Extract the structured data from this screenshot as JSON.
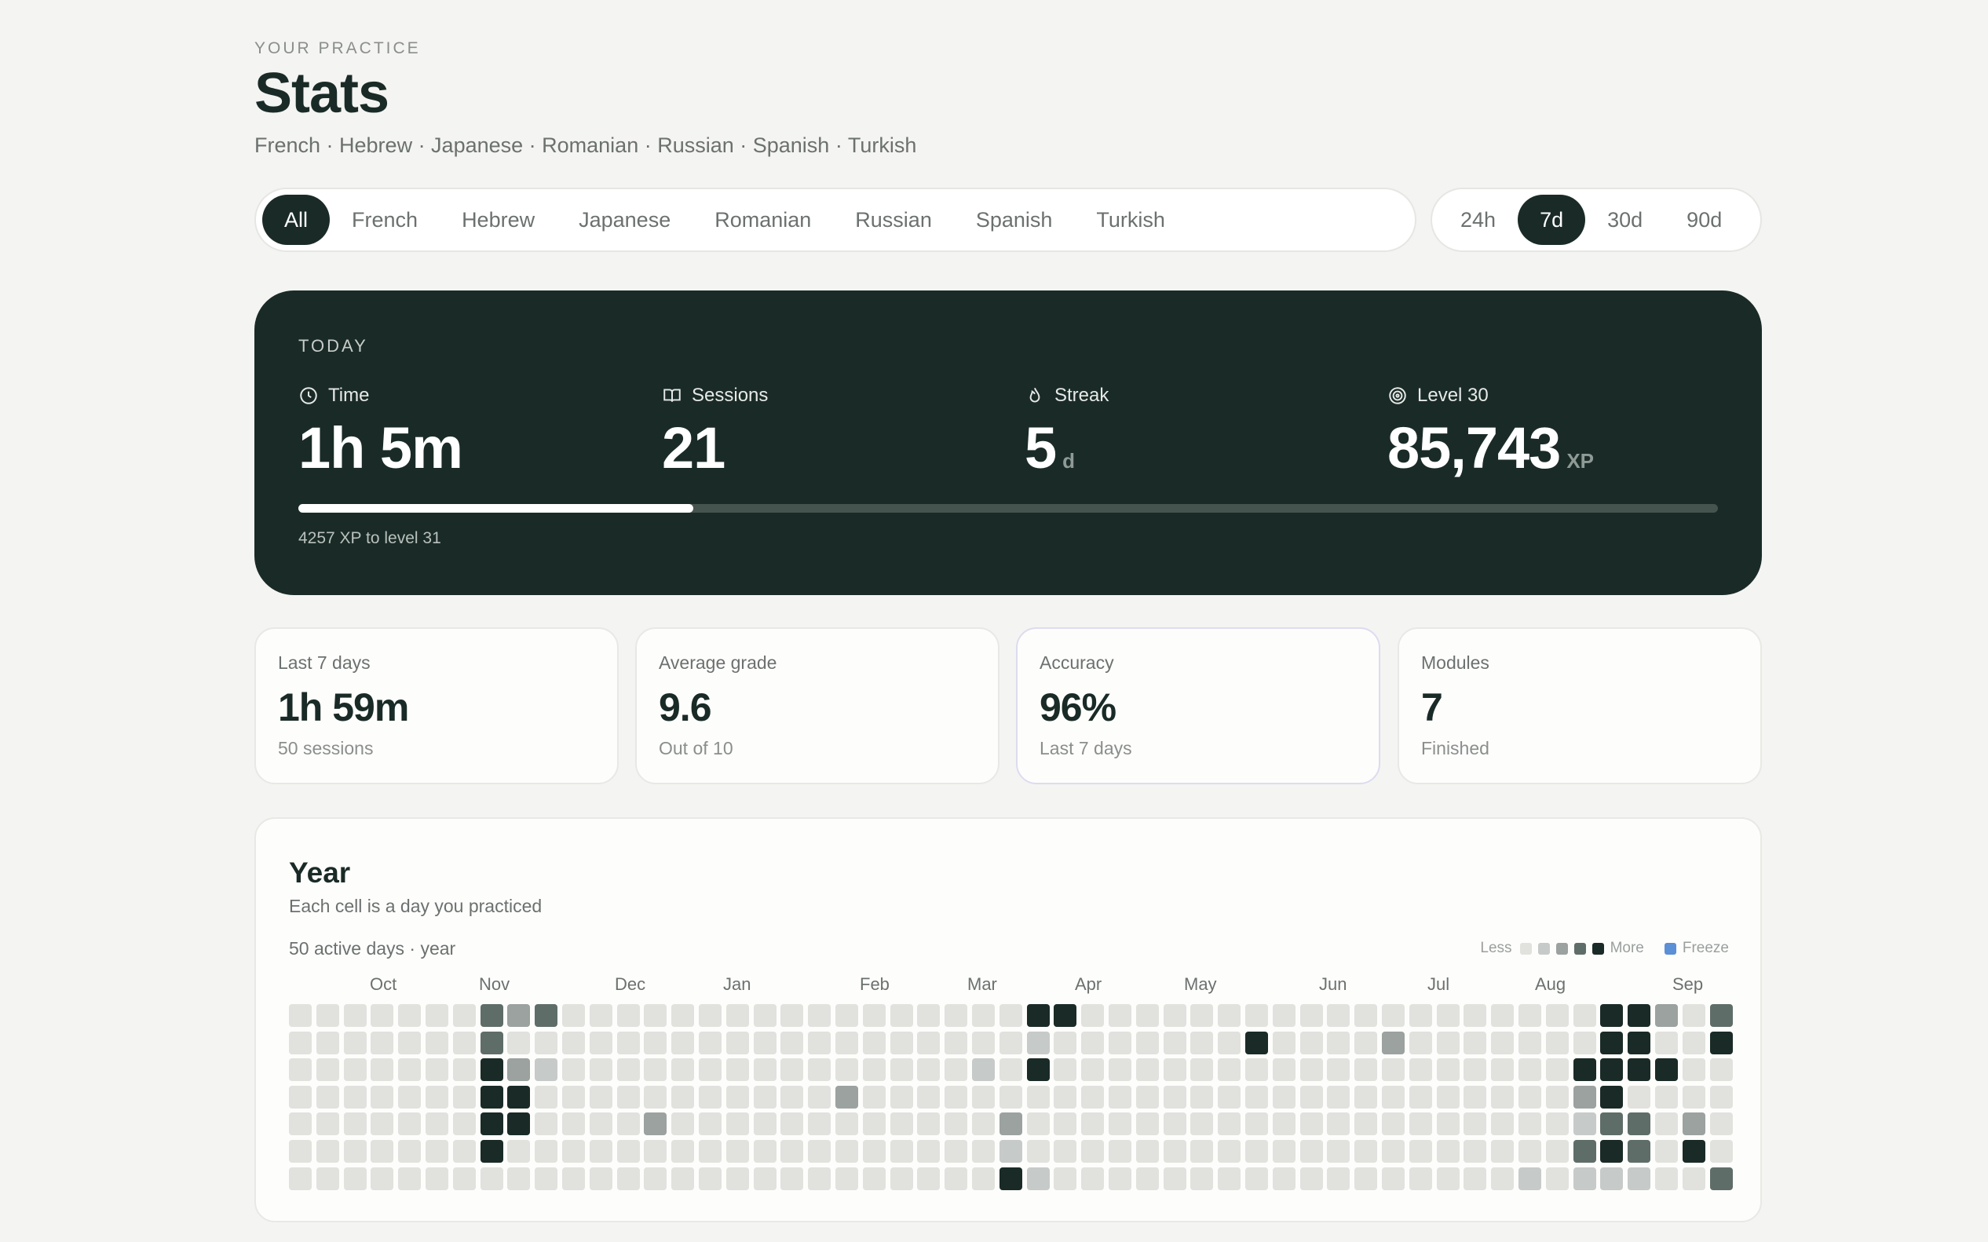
{
  "header": {
    "eyebrow": "YOUR PRACTICE",
    "title": "Stats",
    "languages_line": "French · Hebrew · Japanese · Romanian · Russian · Spanish · Turkish"
  },
  "language_filter": {
    "options": [
      "All",
      "French",
      "Hebrew",
      "Japanese",
      "Romanian",
      "Russian",
      "Spanish",
      "Turkish"
    ],
    "selected": "All"
  },
  "range_filter": {
    "options": [
      "24h",
      "7d",
      "30d",
      "90d"
    ],
    "selected": "7d"
  },
  "today": {
    "label": "TODAY",
    "time": {
      "label": "Time",
      "value": "1h 5m",
      "icon": "clock-icon"
    },
    "sessions": {
      "label": "Sessions",
      "value": "21",
      "icon": "book-icon"
    },
    "streak": {
      "label": "Streak",
      "value": "5",
      "unit": "d",
      "icon": "flame-icon"
    },
    "level": {
      "label": "Level 30",
      "value": "85,743",
      "unit": "XP",
      "icon": "target-icon"
    },
    "progress_fraction": 0.278,
    "xp_note": "4257 XP to level 31"
  },
  "cards": [
    {
      "label": "Last 7 days",
      "value": "1h 59m",
      "sub": "50 sessions"
    },
    {
      "label": "Average grade",
      "value": "9.6",
      "sub": "Out of 10"
    },
    {
      "label": "Accuracy",
      "value": "96%",
      "sub": "Last 7 days"
    },
    {
      "label": "Modules",
      "value": "7",
      "sub": "Finished"
    }
  ],
  "year": {
    "title": "Year",
    "subtitle": "Each cell is a day you practiced",
    "active": "50 active days · year",
    "legend": {
      "less": "Less",
      "more": "More",
      "freeze": "Freeze"
    },
    "months": [
      "Oct",
      "Nov",
      "Dec",
      "Jan",
      "Feb",
      "Mar",
      "Apr",
      "May",
      "Jun",
      "Jul",
      "Aug",
      "Sep"
    ],
    "colors": {
      "0": "#e1e1de",
      "1": "#c6cac8",
      "2": "#9ba29f",
      "3": "#5f6d68",
      "4": "#1a2b27",
      "freeze": "#5b8fd6"
    },
    "active_cells": [
      [
        7,
        0,
        3
      ],
      [
        8,
        0,
        2
      ],
      [
        9,
        0,
        3
      ],
      [
        7,
        1,
        3
      ],
      [
        7,
        2,
        4
      ],
      [
        8,
        2,
        2
      ],
      [
        9,
        2,
        1
      ],
      [
        7,
        3,
        4
      ],
      [
        8,
        3,
        4
      ],
      [
        7,
        4,
        4
      ],
      [
        8,
        4,
        4
      ],
      [
        7,
        5,
        4
      ],
      [
        13,
        4,
        2
      ],
      [
        20,
        3,
        2
      ],
      [
        25,
        2,
        1
      ],
      [
        26,
        4,
        2
      ],
      [
        26,
        5,
        1
      ],
      [
        26,
        6,
        4
      ],
      [
        27,
        0,
        4
      ],
      [
        28,
        0,
        4
      ],
      [
        27,
        1,
        1
      ],
      [
        27,
        2,
        4
      ],
      [
        27,
        6,
        1
      ],
      [
        35,
        1,
        4
      ],
      [
        40,
        1,
        2
      ],
      [
        45,
        6,
        1
      ],
      [
        47,
        2,
        4
      ],
      [
        47,
        3,
        2
      ],
      [
        47,
        4,
        1
      ],
      [
        47,
        5,
        3
      ],
      [
        47,
        6,
        1
      ],
      [
        48,
        0,
        4
      ],
      [
        48,
        1,
        4
      ],
      [
        48,
        2,
        4
      ],
      [
        48,
        3,
        4
      ],
      [
        48,
        4,
        3
      ],
      [
        48,
        5,
        4
      ],
      [
        48,
        6,
        1
      ],
      [
        49,
        0,
        4
      ],
      [
        49,
        1,
        4
      ],
      [
        49,
        2,
        4
      ],
      [
        49,
        4,
        3
      ],
      [
        49,
        5,
        3
      ],
      [
        49,
        6,
        1
      ],
      [
        50,
        0,
        2
      ],
      [
        50,
        2,
        4
      ],
      [
        51,
        4,
        2
      ],
      [
        51,
        5,
        4
      ],
      [
        52,
        0,
        3
      ],
      [
        52,
        1,
        4
      ],
      [
        52,
        6,
        3
      ]
    ]
  }
}
